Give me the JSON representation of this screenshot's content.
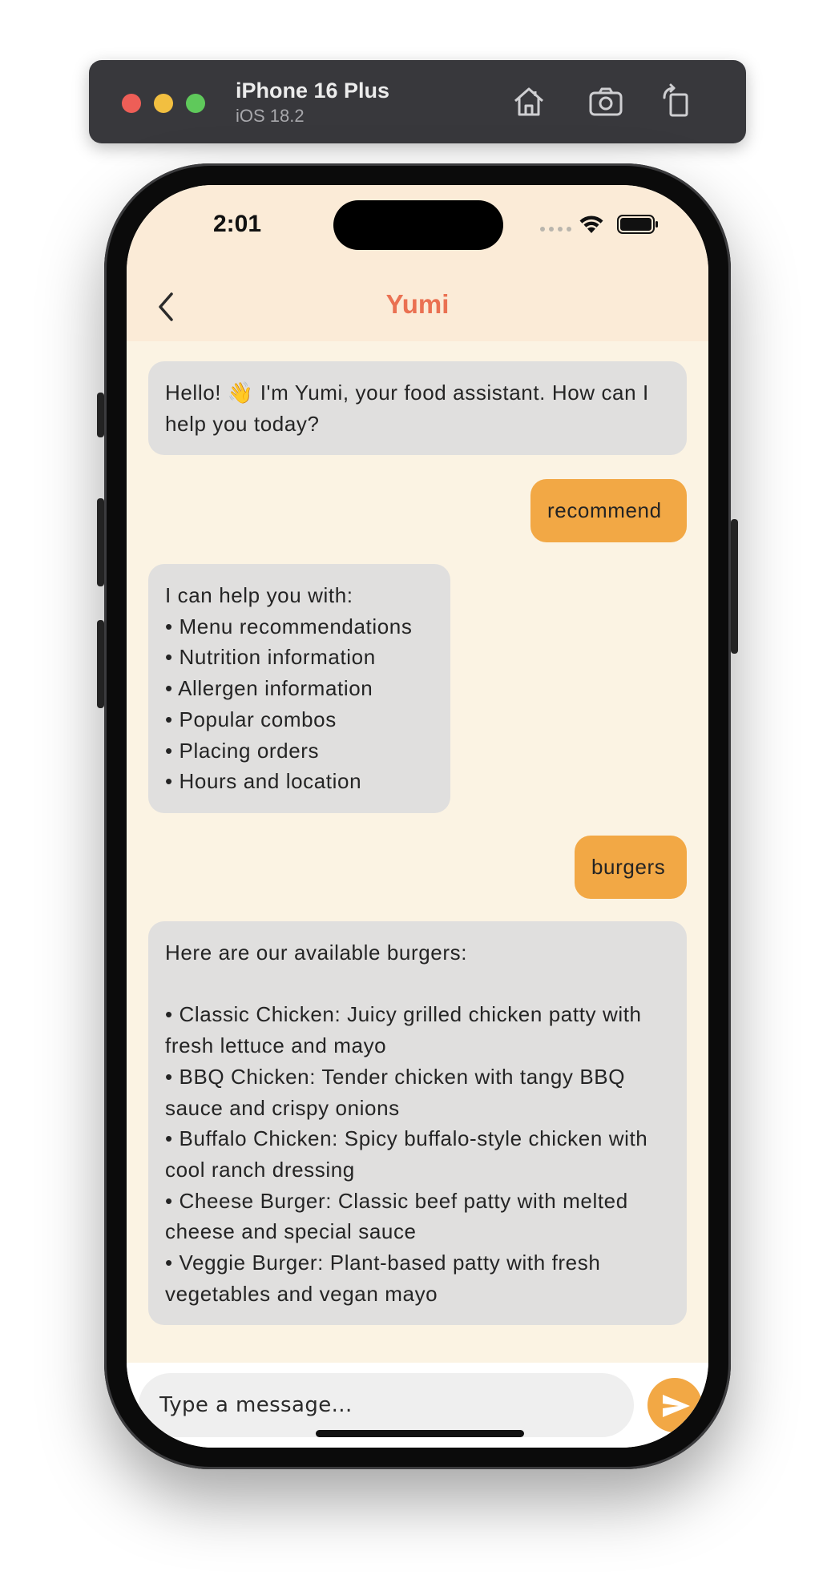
{
  "simulator": {
    "device_name": "iPhone 16 Plus",
    "os_version": "iOS 18.2",
    "toolbar_icons": [
      "home-icon",
      "screenshot-icon",
      "rotate-icon"
    ]
  },
  "status_bar": {
    "time": "2:01",
    "icons": [
      "cellular-signal-icon",
      "wifi-icon",
      "battery-icon"
    ]
  },
  "header": {
    "title": "Yumi",
    "back_icon": "chevron-left-icon"
  },
  "messages": [
    {
      "sender": "bot",
      "text": "Hello! 👋 I'm Yumi, your food assistant. How can I help you today?"
    },
    {
      "sender": "user",
      "text": "recommend"
    },
    {
      "sender": "bot",
      "text": "I can help you with:\n• Menu recommendations\n• Nutrition information\n• Allergen information\n• Popular combos\n• Placing orders\n• Hours and location"
    },
    {
      "sender": "user",
      "text": "burgers"
    },
    {
      "sender": "bot",
      "text": "Here are our available burgers:\n\n• Classic Chicken: Juicy grilled chicken patty with fresh lettuce and mayo\n• BBQ Chicken: Tender chicken with tangy BBQ sauce and crispy onions\n• Buffalo Chicken: Spicy buffalo-style chicken with cool ranch dressing\n• Cheese Burger: Classic beef patty with melted cheese and special sauce\n• Veggie Burger: Plant-based patty with fresh vegetables and vegan mayo"
    }
  ],
  "input": {
    "value": "",
    "placeholder": "Type a message...",
    "send_icon": "send-icon"
  },
  "colors": {
    "accent": "#f2a845",
    "title": "#ea7152",
    "header_bg": "#fbebd7",
    "chat_bg": "#fbf3e3",
    "bot_bubble": "#e0dfde"
  }
}
